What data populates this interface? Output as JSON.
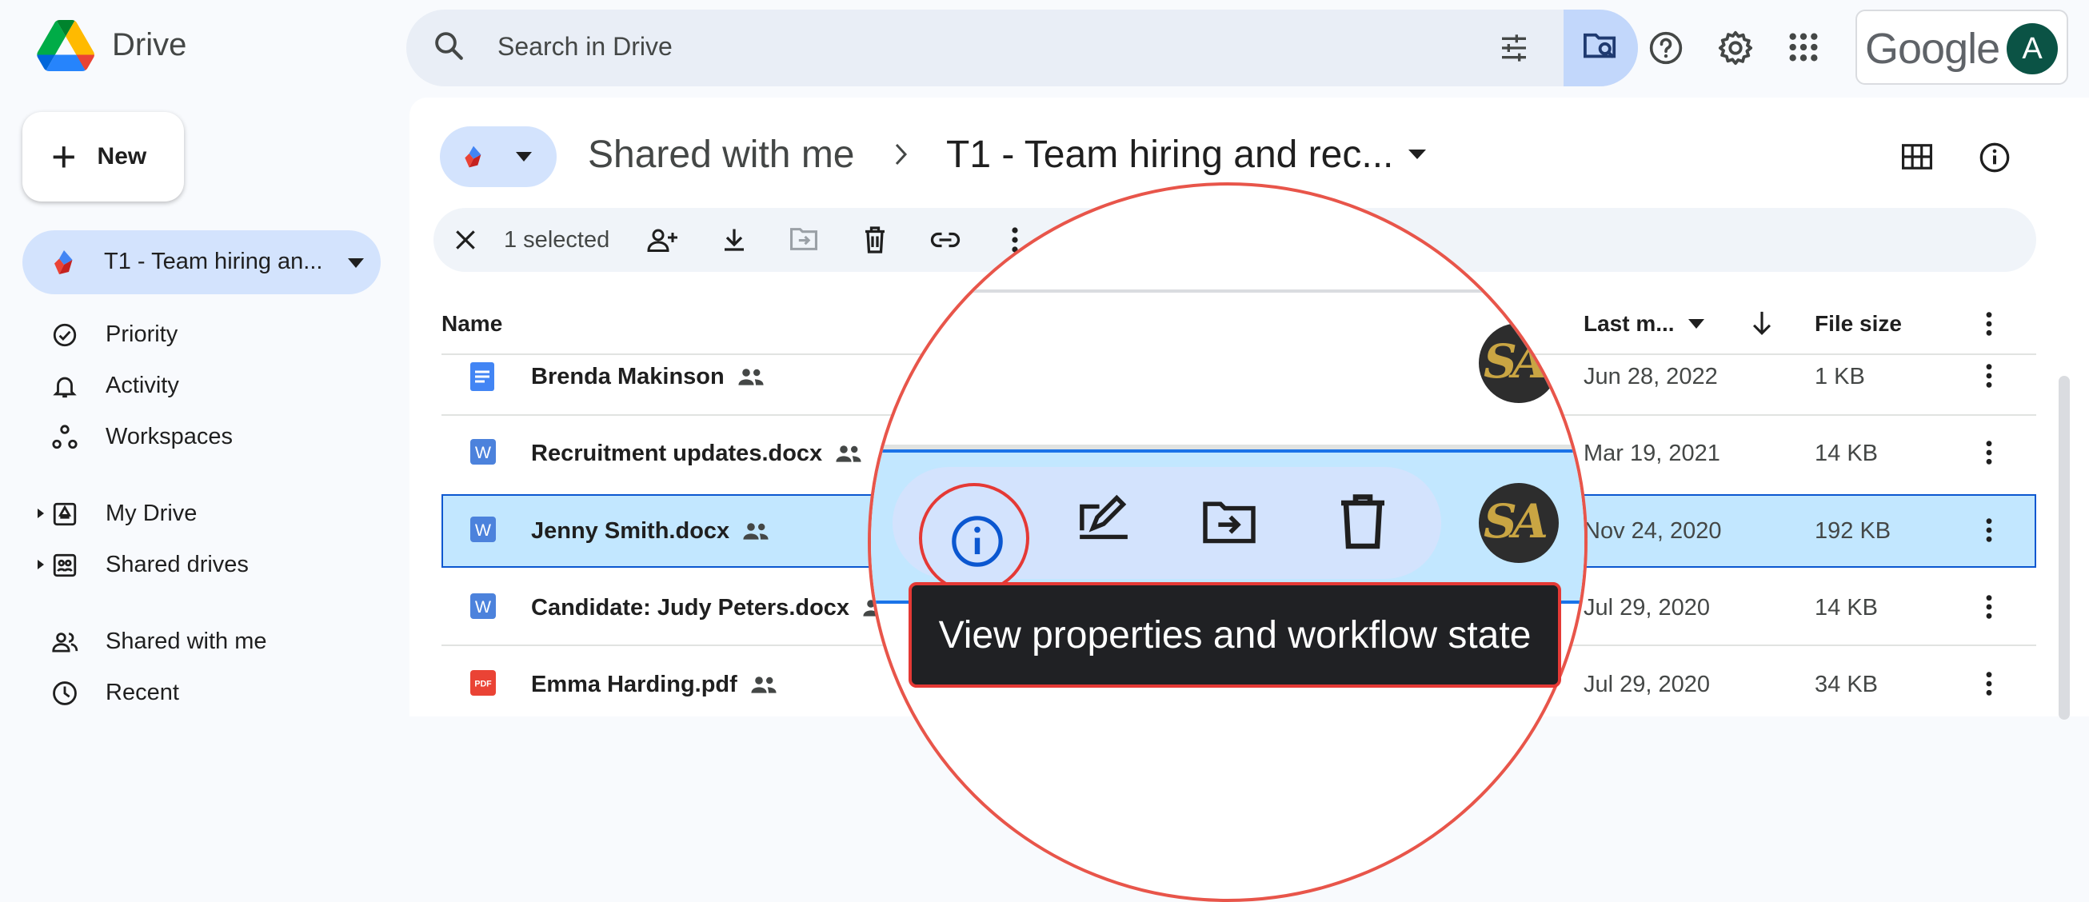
{
  "header": {
    "app_title": "Drive",
    "search_placeholder": "Search in Drive",
    "google_wordmark": "Google",
    "avatar_letter": "A"
  },
  "sidebar": {
    "new_label": "New",
    "workspace_label": "T1 - Team hiring an...",
    "items": [
      {
        "label": "Priority",
        "icon": "priority-check-icon"
      },
      {
        "label": "Activity",
        "icon": "bell-icon"
      },
      {
        "label": "Workspaces",
        "icon": "workspaces-icon"
      },
      {
        "label": "My Drive",
        "icon": "my-drive-icon"
      },
      {
        "label": "Shared drives",
        "icon": "shared-drives-icon"
      },
      {
        "label": "Shared with me",
        "icon": "people-icon"
      },
      {
        "label": "Recent",
        "icon": "clock-icon"
      }
    ]
  },
  "breadcrumb": {
    "parent": "Shared with me",
    "current": "T1 - Team hiring and rec..."
  },
  "selection": {
    "count_text": "1 selected"
  },
  "table": {
    "columns": {
      "name": "Name",
      "last_modified": "Last m...",
      "file_size": "File size"
    },
    "rows": [
      {
        "name": "Brenda Makinson",
        "type": "doc",
        "date": "Jun 28, 2022",
        "size": "1 KB",
        "selected": false
      },
      {
        "name": "Recruitment updates.docx",
        "type": "word",
        "date": "Mar 19, 2021",
        "size": "14 KB",
        "selected": false
      },
      {
        "name": "Jenny Smith.docx",
        "type": "word",
        "date": "Nov 24, 2020",
        "size": "192 KB",
        "selected": true
      },
      {
        "name": "Candidate: Judy Peters.docx",
        "type": "word",
        "date": "Jul 29, 2020",
        "size": "14 KB",
        "selected": false
      },
      {
        "name": "Emma Harding.pdf",
        "type": "pdf",
        "date": "Jul 29, 2020",
        "size": "34 KB",
        "selected": false
      }
    ],
    "owner_initials": "SA"
  },
  "magnifier": {
    "tooltip": "View properties and workflow state"
  },
  "colors": {
    "accent": "#0b57d0",
    "selected_row": "#c2e7ff",
    "highlight_ring": "#e53935"
  }
}
